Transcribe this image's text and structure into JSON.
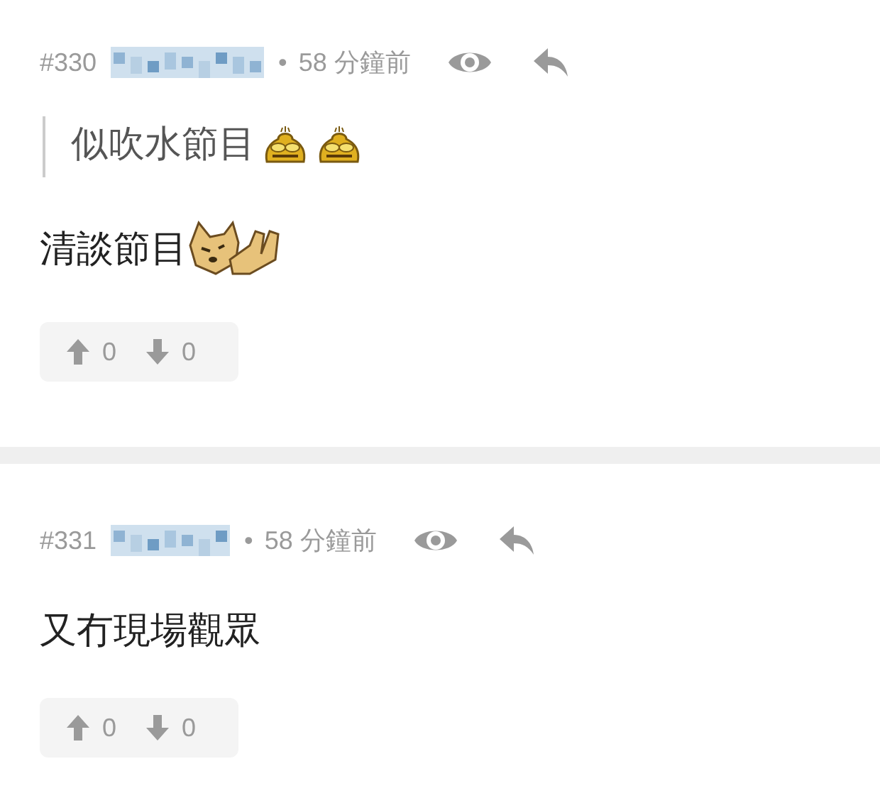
{
  "posts": [
    {
      "number": "#330",
      "separator": "•",
      "time": "58 分鐘前",
      "blocks": [
        {
          "kind": "quote",
          "parts": [
            {
              "kind": "text",
              "text": "似吹水節目"
            },
            {
              "kind": "sticker-face"
            },
            {
              "kind": "sticker-face"
            }
          ]
        },
        {
          "kind": "paragraph",
          "parts": [
            {
              "kind": "text",
              "text": "清談節目"
            },
            {
              "kind": "sticker-dog"
            }
          ]
        }
      ],
      "upvotes": "0",
      "downvotes": "0"
    },
    {
      "number": "#331",
      "separator": "•",
      "time": "58 分鐘前",
      "blocks": [
        {
          "kind": "paragraph",
          "parts": [
            {
              "kind": "text",
              "text": "又冇現場觀眾"
            }
          ]
        }
      ],
      "upvotes": "0",
      "downvotes": "0"
    }
  ]
}
